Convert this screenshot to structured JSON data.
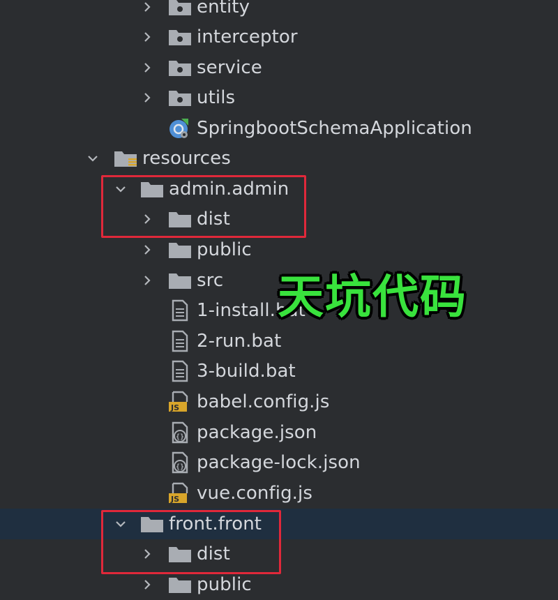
{
  "tree": {
    "items": [
      {
        "label": "entity",
        "icon": "package-icon",
        "chevron": "right"
      },
      {
        "label": "interceptor",
        "icon": "package-icon",
        "chevron": "right"
      },
      {
        "label": "service",
        "icon": "package-icon",
        "chevron": "right"
      },
      {
        "label": "utils",
        "icon": "package-icon",
        "chevron": "right"
      },
      {
        "label": "SpringbootSchemaApplication",
        "icon": "spring-boot-class-icon",
        "chevron": "none"
      },
      {
        "label": "resources",
        "icon": "resources-folder-icon",
        "chevron": "down"
      },
      {
        "label": "admin.admin",
        "icon": "folder-icon",
        "chevron": "down"
      },
      {
        "label": "dist",
        "icon": "folder-icon",
        "chevron": "right"
      },
      {
        "label": "public",
        "icon": "folder-icon",
        "chevron": "right"
      },
      {
        "label": "src",
        "icon": "folder-icon",
        "chevron": "right"
      },
      {
        "label": "1-install.bat",
        "icon": "text-file-icon",
        "chevron": "none"
      },
      {
        "label": "2-run.bat",
        "icon": "text-file-icon",
        "chevron": "none"
      },
      {
        "label": "3-build.bat",
        "icon": "text-file-icon",
        "chevron": "none"
      },
      {
        "label": "babel.config.js",
        "icon": "javascript-file-icon",
        "chevron": "none"
      },
      {
        "label": "package.json",
        "icon": "json-file-icon",
        "chevron": "none"
      },
      {
        "label": "package-lock.json",
        "icon": "json-file-icon",
        "chevron": "none"
      },
      {
        "label": "vue.config.js",
        "icon": "javascript-file-icon",
        "chevron": "none"
      },
      {
        "label": "front.front",
        "icon": "folder-icon",
        "chevron": "down",
        "selected": true
      },
      {
        "label": "dist",
        "icon": "folder-icon",
        "chevron": "right"
      },
      {
        "label": "public",
        "icon": "folder-icon",
        "chevron": "right"
      }
    ]
  },
  "watermark": {
    "text": "天坑代码"
  },
  "colors": {
    "background": "#2b2d30",
    "selected_row": "#1f2f40",
    "highlight_box": "#e0283a",
    "watermark": "#39e23d"
  }
}
